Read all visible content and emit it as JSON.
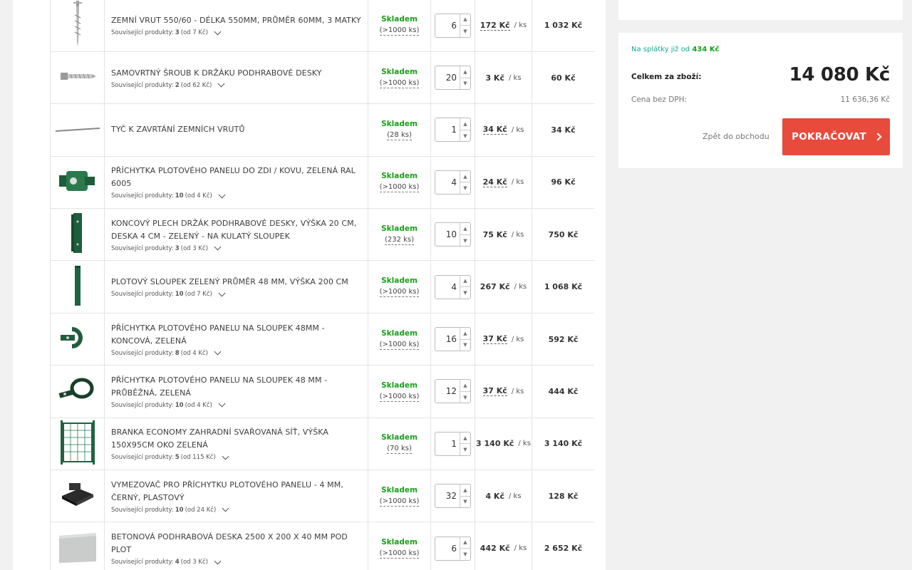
{
  "cart": {
    "items": [
      {
        "name": "ZEMNÍ VRUT 550/60 - DÉLKA 550MM, PRŮMĚR 60MM, 3 MATKY",
        "related_label": "Související produkty:",
        "related_count": "3",
        "related_from": "(od 7 Kč)",
        "stock_label": "Skladem",
        "stock_qty": "(>1000 ks)",
        "quantity": "6",
        "unit_price": "172 Kč",
        "unit_price_dashed": true,
        "per_unit": "/ ks",
        "total": "1 032 Kč",
        "image": "ground-screw"
      },
      {
        "name": "SAMOVRTNÝ ŠROUB K DRŽÁKU PODHRABOVÉ DESKY",
        "related_label": "Související produkty:",
        "related_count": "2",
        "related_from": "(od 62 Kč)",
        "stock_label": "Skladem",
        "stock_qty": "(>1000 ks)",
        "quantity": "20",
        "unit_price": "3 Kč",
        "unit_price_dashed": false,
        "per_unit": "/ ks",
        "total": "60 Kč",
        "image": "self-drilling-screw"
      },
      {
        "name": "TYČ K ZAVRTÁNÍ ZEMNÍCH VRUTŮ",
        "related_label": "",
        "related_count": "",
        "related_from": "",
        "stock_label": "Skladem",
        "stock_qty": "(28 ks)",
        "quantity": "1",
        "unit_price": "34 Kč",
        "unit_price_dashed": true,
        "per_unit": "/ ks",
        "total": "34 Kč",
        "image": "rod"
      },
      {
        "name": "PŘÍCHYTKA PLOTOVÉHO PANELU DO ZDI / KOVU, ZELENÁ RAL 6005",
        "related_label": "Související produkty:",
        "related_count": "10",
        "related_from": "(od 4 Kč)",
        "stock_label": "Skladem",
        "stock_qty": "(>1000 ks)",
        "quantity": "4",
        "unit_price": "24 Kč",
        "unit_price_dashed": true,
        "per_unit": "/ ks",
        "total": "96 Kč",
        "image": "wall-clip"
      },
      {
        "name": "KONCOVÝ PLECH DRŽÁK PODHRABOVÉ DESKY, VÝŠKA 20 CM, DESKA 4 CM - ZELENÝ - NA KULATÝ SLOUPEK",
        "related_label": "Související produkty:",
        "related_count": "3",
        "related_from": "(od 3 Kč)",
        "stock_label": "Skladem",
        "stock_qty": "(232 ks)",
        "quantity": "10",
        "unit_price": "75 Kč",
        "unit_price_dashed": false,
        "per_unit": "/ ks",
        "total": "750 Kč",
        "image": "end-plate"
      },
      {
        "name": "PLOTOVÝ SLOUPEK ZELENÝ PRŮMĚR 48 MM, VÝŠKA 200 CM",
        "related_label": "Související produkty:",
        "related_count": "10",
        "related_from": "(od 7 Kč)",
        "stock_label": "Skladem",
        "stock_qty": "(>1000 ks)",
        "quantity": "4",
        "unit_price": "267 Kč",
        "unit_price_dashed": false,
        "per_unit": "/ ks",
        "total": "1 068 Kč",
        "image": "post"
      },
      {
        "name": "PŘÍCHYTKA PLOTOVÉHO PANELU NA SLOUPEK 48MM - KONCOVÁ, ZELENÁ",
        "related_label": "Související produkty:",
        "related_count": "8",
        "related_from": "(od 4 Kč)",
        "stock_label": "Skladem",
        "stock_qty": "(>1000 ks)",
        "quantity": "16",
        "unit_price": "37 Kč",
        "unit_price_dashed": true,
        "per_unit": "/ ks",
        "total": "592 Kč",
        "image": "end-clip"
      },
      {
        "name": "PŘÍCHYTKA PLOTOVÉHO PANELU NA SLOUPEK 48 MM - PRŮBĚŽNÁ, ZELENÁ",
        "related_label": "Související produkty:",
        "related_count": "10",
        "related_from": "(od 4 Kč)",
        "stock_label": "Skladem",
        "stock_qty": "(>1000 ks)",
        "quantity": "12",
        "unit_price": "37 Kč",
        "unit_price_dashed": true,
        "per_unit": "/ ks",
        "total": "444 Kč",
        "image": "mid-clip"
      },
      {
        "name": "BRANKA ECONOMY ZAHRADNÍ SVAŘOVANÁ SÍŤ, VÝŠKA 150X95CM OKO ZELENÁ",
        "related_label": "Související produkty:",
        "related_count": "5",
        "related_from": "(od 115 Kč)",
        "stock_label": "Skladem",
        "stock_qty": "(70 ks)",
        "quantity": "1",
        "unit_price": "3 140 Kč",
        "unit_price_dashed": false,
        "per_unit": "/ ks",
        "total": "3 140 Kč",
        "image": "gate"
      },
      {
        "name": "VYMEZOVAČ PRO PŘÍCHYTKU PLOTOVÉHO PANELU - 4 MM, ČERNÝ, PLASTOVÝ",
        "related_label": "Související produkty:",
        "related_count": "10",
        "related_from": "(od 24 Kč)",
        "stock_label": "Skladem",
        "stock_qty": "(>1000 ks)",
        "quantity": "32",
        "unit_price": "4 Kč",
        "unit_price_dashed": false,
        "per_unit": "/ ks",
        "total": "128 Kč",
        "image": "spacer"
      },
      {
        "name": "BETONOVÁ PODHRABOVÁ DESKA 2500 X 200 X 40 MM POD PLOT",
        "related_label": "Související produkty:",
        "related_count": "4",
        "related_from": "(od 3 Kč)",
        "stock_label": "Skladem",
        "stock_qty": "(>1000 ks)",
        "quantity": "6",
        "unit_price": "442 Kč",
        "unit_price_dashed": false,
        "per_unit": "/ ks",
        "total": "2 652 Kč",
        "image": "concrete-board"
      }
    ]
  },
  "summary": {
    "installments_prefix": "Na splátky již od",
    "installments_amount": "434 Kč",
    "total_label": "Celkem za zboží:",
    "grand_total": "14 080 Kč",
    "vat_label": "Cena bez DPH:",
    "vat_value": "11 636,36 Kč",
    "back_link": "Zpět do obchodu",
    "continue_label": "POKRAČOVAT"
  },
  "colors": {
    "in_stock": "#17a118",
    "primary_button": "#e84a3c",
    "installments": "#17a88e"
  }
}
